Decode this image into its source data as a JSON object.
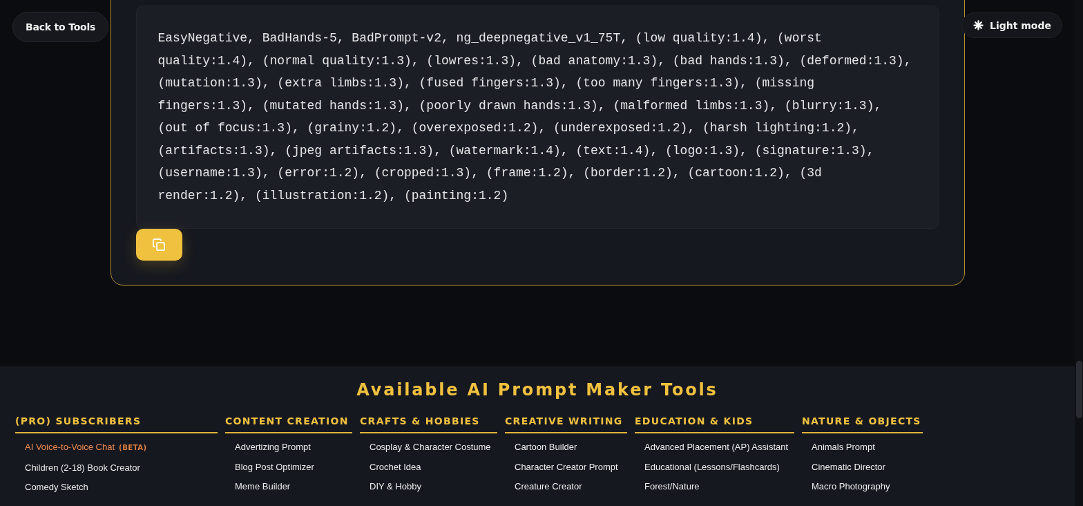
{
  "nav": {
    "back_button": "Back to Tools",
    "theme_toggle": "Light mode"
  },
  "prompt_card": {
    "text": "EasyNegative, BadHands-5, BadPrompt-v2, ng_deepnegative_v1_75T, (low quality:1.4), (worst quality:1.4), (normal quality:1.3), (lowres:1.3), (bad anatomy:1.3), (bad hands:1.3), (deformed:1.3), (mutation:1.3), (extra limbs:1.3), (fused fingers:1.3), (too many fingers:1.3), (missing fingers:1.3), (mutated hands:1.3), (poorly drawn hands:1.3), (malformed limbs:1.3), (blurry:1.3), (out of focus:1.3), (grainy:1.2), (overexposed:1.2), (underexposed:1.2), (harsh lighting:1.2), (artifacts:1.3), (jpeg artifacts:1.3), (watermark:1.4), (text:1.4), (logo:1.3), (signature:1.3), (username:1.3), (error:1.2), (cropped:1.3), (frame:1.2), (border:1.2), (cartoon:1.2), (3d render:1.2), (illustration:1.2), (painting:1.2)"
  },
  "footer": {
    "title": "Available AI Prompt Maker Tools",
    "columns": [
      {
        "heading": "(PRO) SUBSCRIBERS",
        "items": [
          {
            "label": "AI Voice-to-Voice Chat",
            "badge": "(BETA)",
            "kind": "featured"
          },
          {
            "label": "Children (2-18) Book Creator",
            "kind": "standard"
          },
          {
            "label": "Comedy Sketch",
            "kind": "standard"
          }
        ]
      },
      {
        "heading": "CONTENT CREATION",
        "items": [
          {
            "label": "Advertizing Prompt",
            "kind": "standard"
          },
          {
            "label": "Blog Post Optimizer",
            "kind": "standard"
          },
          {
            "label": "Meme Builder",
            "kind": "standard"
          }
        ]
      },
      {
        "heading": "CRAFTS & HOBBIES",
        "items": [
          {
            "label": "Cosplay & Character Costume",
            "kind": "standard"
          },
          {
            "label": "Crochet Idea",
            "kind": "standard"
          },
          {
            "label": "DIY & Hobby",
            "kind": "standard"
          }
        ]
      },
      {
        "heading": "CREATIVE WRITING",
        "items": [
          {
            "label": "Cartoon Builder",
            "kind": "standard"
          },
          {
            "label": "Character Creator Prompt",
            "kind": "standard"
          },
          {
            "label": "Creature Creator",
            "kind": "standard"
          }
        ]
      },
      {
        "heading": "EDUCATION & KIDS",
        "items": [
          {
            "label": "Advanced Placement (AP) Assistant",
            "kind": "standard"
          },
          {
            "label": "Educational (Lessons/Flashcards)",
            "kind": "standard"
          },
          {
            "label": "Forest/Nature",
            "kind": "standard"
          }
        ]
      },
      {
        "heading": "NATURE & OBJECTS",
        "items": [
          {
            "label": "Animals Prompt",
            "kind": "standard"
          },
          {
            "label": "Cinematic Director",
            "kind": "standard"
          },
          {
            "label": "Macro Photography",
            "kind": "standard"
          }
        ]
      }
    ]
  }
}
